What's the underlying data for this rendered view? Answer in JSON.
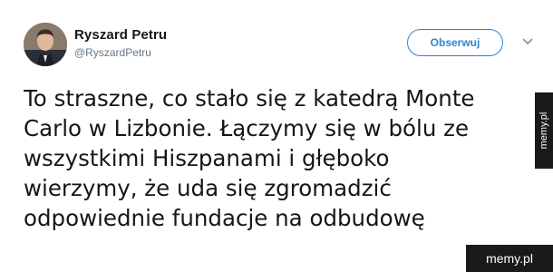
{
  "tweet": {
    "author": {
      "name": "Ryszard Petru",
      "handle": "@RyszardPetru",
      "avatar_icon": "avatar-photo"
    },
    "follow_label": "Obserwuj",
    "menu_icon": "chevron-down-icon",
    "text": "To straszne, co stało się z katedrą Monte\nCarlo w Lizbonie. Łączymy się w bólu ze\nwszystkimi Hiszpanami i głęboko\nwierzymy, że uda się zgromadzić\nodpowiednie fundacje na odbudowę"
  },
  "watermarks": {
    "side_text": "memy.pl",
    "corner_text": "memy.pl"
  },
  "colors": {
    "accent": "#2f84d2",
    "text": "#14171a",
    "muted": "#657786",
    "watermark_bg": "#1a1a1a"
  }
}
